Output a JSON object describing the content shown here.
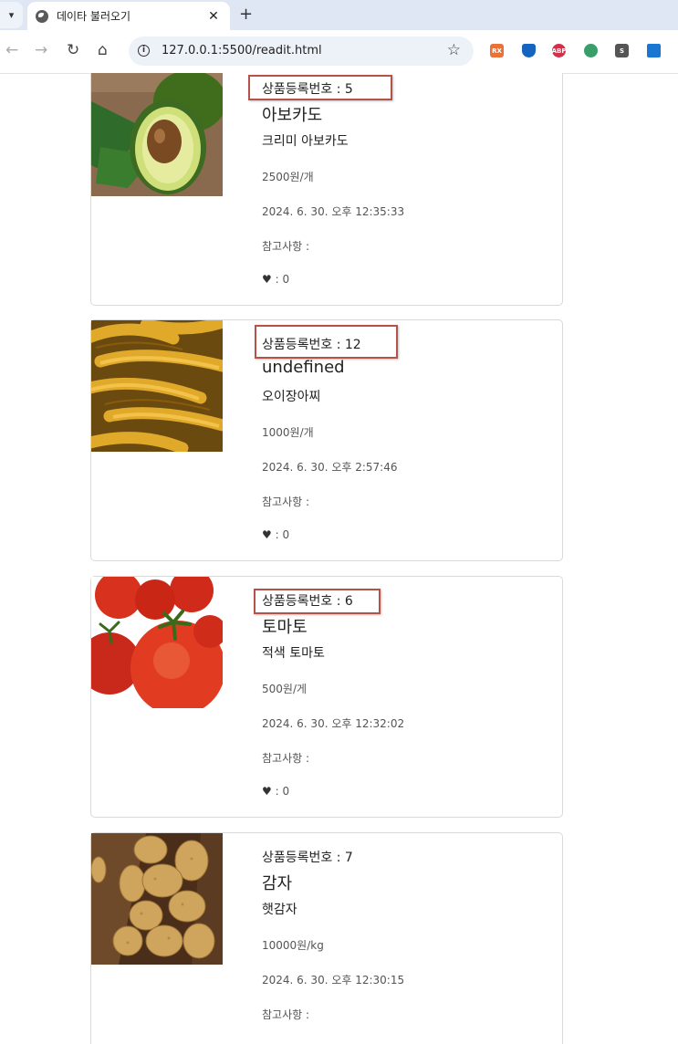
{
  "browser": {
    "tab_title": "데이타 불러오기",
    "tab_close": "✕",
    "new_tab": "+",
    "url": "127.0.0.1:5500/readit.html",
    "ext_labels": [
      "RX",
      "",
      "ABP",
      "",
      "S",
      ""
    ]
  },
  "products": [
    {
      "reg_no_label": "상품등록번호 : 5",
      "name": "아보카도",
      "description": "크리미 아보카도",
      "price": "2500원/개",
      "date": "2024. 6. 30. 오후 12:35:33",
      "note": "참고사항 :",
      "likes": ": 0",
      "image": "avocado"
    },
    {
      "reg_no_label": "상품등록번호 : 12",
      "name": "undefined",
      "description": "오이장아찌",
      "price": "1000원/개",
      "date": "2024. 6. 30. 오후 2:57:46",
      "note": "참고사항 :",
      "likes": ": 0",
      "image": "pickled-cucumber"
    },
    {
      "reg_no_label": "상품등록번호 : 6",
      "name": "토마토",
      "description": "적색 토마토",
      "price": "500원/게",
      "date": "2024. 6. 30. 오후 12:32:02",
      "note": "참고사항 :",
      "likes": ": 0",
      "image": "tomato"
    },
    {
      "reg_no_label": "상품등록번호 : 7",
      "name": "감자",
      "description": "햇감자",
      "price": "10000원/kg",
      "date": "2024. 6. 30. 오후 12:30:15",
      "note": "참고사항 :",
      "likes": "",
      "image": "potato"
    }
  ],
  "colors": {
    "highlight_box": "#b5524a",
    "card_border": "#d9d9d9",
    "tabbar_bg": "#dfe6f4"
  }
}
